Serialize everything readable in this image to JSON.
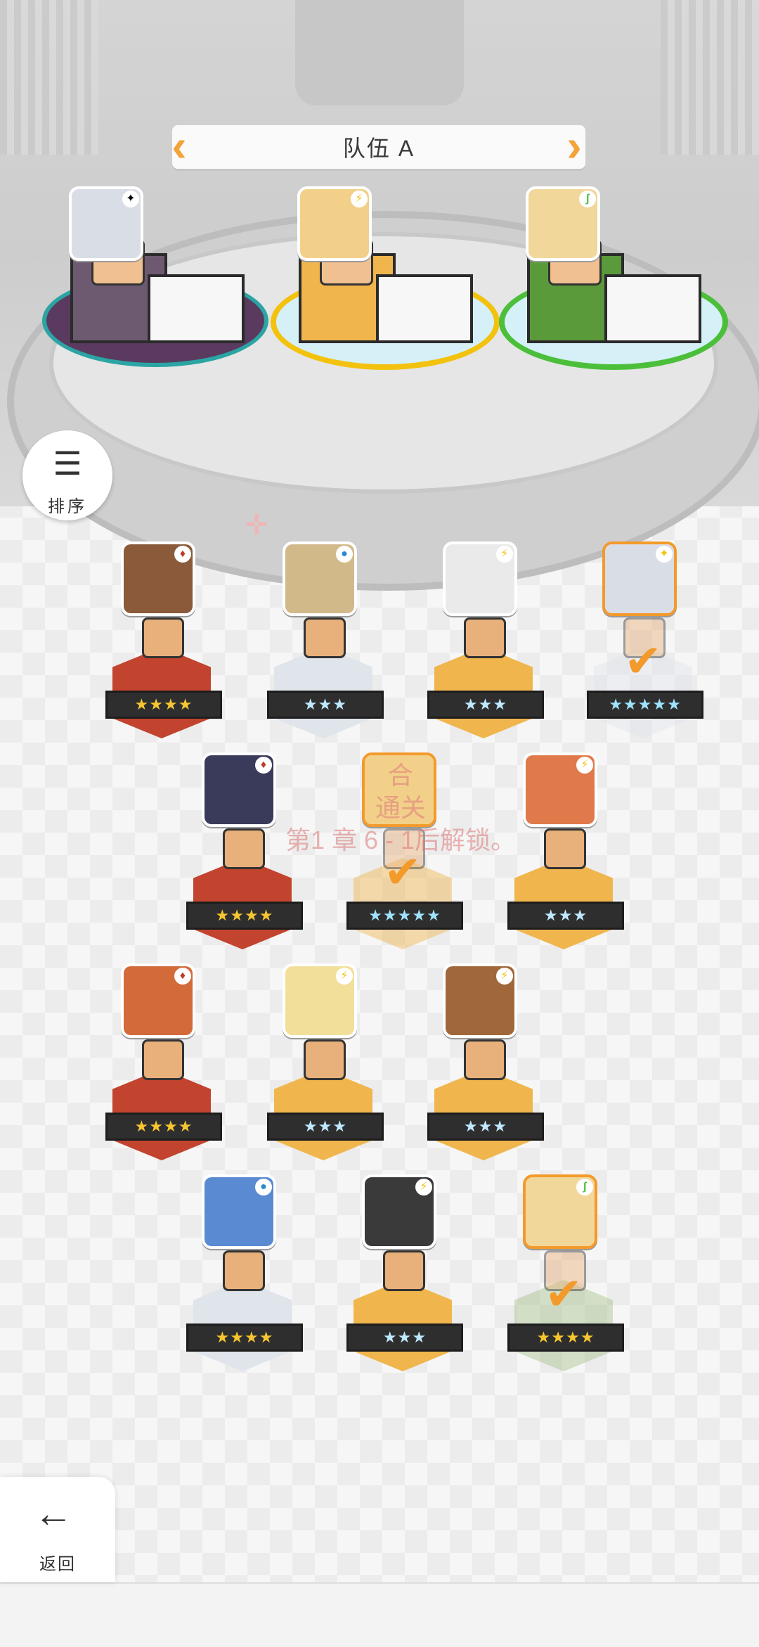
{
  "team": {
    "title": "队伍 A",
    "prev_icon": "chevron-left-icon",
    "next_icon": "chevron-right-icon"
  },
  "sort": {
    "label": "排序",
    "icon": "sort-icon"
  },
  "back": {
    "label": "返回",
    "icon": "arrow-left-icon"
  },
  "lock_message": [
    "合",
    "通关",
    "第1 章 6 - 1后解锁。"
  ],
  "colors": {
    "accent": "#f39a2b",
    "purple": "#5a3a5e",
    "yellow": "#f2c20f",
    "green": "#4bbf3a",
    "red": "#c0392b",
    "silver": "#dfe5ea",
    "gold": "#f0b64d"
  },
  "team_slots": [
    {
      "element": "dark",
      "element_glyph": "✦",
      "face_color": "#d9dde6",
      "platform": "purple"
    },
    {
      "element": "lightning",
      "element_glyph": "⚡",
      "face_color": "#f2d08a",
      "platform": "yellow"
    },
    {
      "element": "nature",
      "element_glyph": "ʃ",
      "face_color": "#f2d79a",
      "platform": "green"
    }
  ],
  "roster": [
    {
      "stars": "★★★★",
      "element_glyph": "♦",
      "pedestal": "red",
      "face_color": "#8a5a3a",
      "selected": false
    },
    {
      "stars": "★★★",
      "element_glyph": "●",
      "pedestal": "silver",
      "face_color": "#d2b98a",
      "selected": false
    },
    {
      "stars": "★★★",
      "element_glyph": "⚡",
      "pedestal": "gold",
      "face_color": "#eaeaea",
      "selected": false
    },
    {
      "stars": "★★★★★",
      "element_glyph": "✦",
      "pedestal": "silver",
      "face_color": "#d9dde6",
      "selected": true
    },
    {
      "stars": "★★★★",
      "element_glyph": "♦",
      "pedestal": "red",
      "face_color": "#3a3a5a",
      "selected": false
    },
    {
      "stars": "★★★★★",
      "element_glyph": "",
      "pedestal": "gold",
      "face_color": "#f2d08a",
      "selected": true
    },
    {
      "stars": "★★★",
      "element_glyph": "⚡",
      "pedestal": "gold",
      "face_color": "#e07a4a",
      "selected": false
    },
    {
      "stars": "★★★★",
      "element_glyph": "♦",
      "pedestal": "red",
      "face_color": "#d26a3a",
      "selected": false
    },
    {
      "stars": "★★★",
      "element_glyph": "⚡",
      "pedestal": "gold",
      "face_color": "#f2e09a",
      "selected": false
    },
    {
      "stars": "★★★",
      "element_glyph": "⚡",
      "pedestal": "gold",
      "face_color": "#a0683a",
      "selected": false
    },
    {
      "stars": "★★★★",
      "element_glyph": "●",
      "pedestal": "silver",
      "face_color": "#5a8ad2",
      "selected": false
    },
    {
      "stars": "★★★",
      "element_glyph": "⚡",
      "pedestal": "gold",
      "face_color": "#3a3a3a",
      "selected": false
    },
    {
      "stars": "★★★★",
      "element_glyph": "ʃ",
      "pedestal": "green",
      "face_color": "#f2d79a",
      "selected": true
    }
  ]
}
